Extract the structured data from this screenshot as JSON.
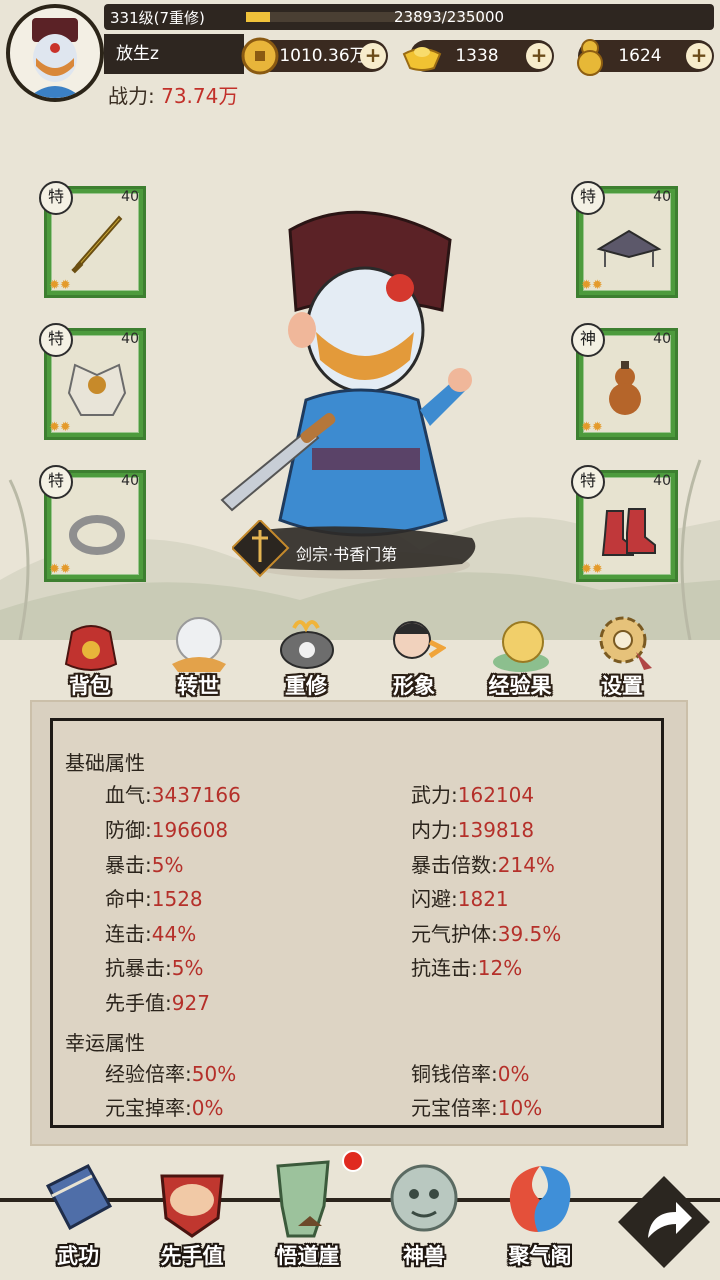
{
  "header": {
    "level_text": "331级(7重修)",
    "exp_text": "23893/235000",
    "exp_progress": 0.1017,
    "player_name": "放生z",
    "currencies": [
      {
        "name": "copper-coin",
        "value": "1010.36万",
        "plus": "+"
      },
      {
        "name": "gold-ingot",
        "value": "1338",
        "plus": "+"
      },
      {
        "name": "gold-gourd",
        "value": "1624",
        "plus": "+"
      }
    ],
    "power_label": "战力:",
    "power_value": "73.74万"
  },
  "equipment": {
    "left": [
      {
        "tag": "特",
        "level": "40",
        "item": "sword",
        "stars": "✹✹"
      },
      {
        "tag": "特",
        "level": "40",
        "item": "armor",
        "stars": "✹✹"
      },
      {
        "tag": "特",
        "level": "40",
        "item": "ring",
        "stars": "✹✹"
      }
    ],
    "right": [
      {
        "tag": "特",
        "level": "40",
        "item": "hat",
        "stars": "✹✹"
      },
      {
        "tag": "神",
        "level": "40",
        "item": "gourd",
        "stars": "✹✹"
      },
      {
        "tag": "特",
        "level": "40",
        "item": "boots",
        "stars": "✹✹"
      }
    ]
  },
  "character": {
    "sect": "剑宗·书香门第"
  },
  "menu": [
    {
      "label": "背包",
      "icon": "bag-icon"
    },
    {
      "label": "转世",
      "icon": "crystal-ball-icon"
    },
    {
      "label": "重修",
      "icon": "cauldron-icon"
    },
    {
      "label": "形象",
      "icon": "avatar-swap-icon"
    },
    {
      "label": "经验果",
      "icon": "exp-fruit-icon"
    },
    {
      "label": "设置",
      "icon": "settings-gear-icon"
    }
  ],
  "stats": {
    "basic_title": "基础属性",
    "basic": [
      {
        "label": "血气:",
        "value": "3437166"
      },
      {
        "label": "武力:",
        "value": "162104"
      },
      {
        "label": "防御:",
        "value": "196608"
      },
      {
        "label": "内力:",
        "value": "139818"
      },
      {
        "label": "暴击:",
        "value": "5%"
      },
      {
        "label": "暴击倍数:",
        "value": "214%"
      },
      {
        "label": "命中:",
        "value": "1528"
      },
      {
        "label": "闪避:",
        "value": "1821"
      },
      {
        "label": "连击:",
        "value": "44%"
      },
      {
        "label": "元气护体:",
        "value": "39.5%"
      },
      {
        "label": "抗暴击:",
        "value": "5%"
      },
      {
        "label": "抗连击:",
        "value": "12%"
      },
      {
        "label": "先手值:",
        "value": "927"
      }
    ],
    "luck_title": "幸运属性",
    "luck": [
      {
        "label": "经验倍率:",
        "value": "50%"
      },
      {
        "label": "铜钱倍率:",
        "value": "0%"
      },
      {
        "label": "元宝掉率:",
        "value": "0%"
      },
      {
        "label": "元宝倍率:",
        "value": "10%"
      }
    ]
  },
  "bottom_nav": [
    {
      "label": "武功",
      "icon": "martial-book-icon"
    },
    {
      "label": "先手值",
      "icon": "fist-icon"
    },
    {
      "label": "悟道崖",
      "icon": "cliff-icon"
    },
    {
      "label": "神兽",
      "icon": "beast-icon"
    },
    {
      "label": "聚气阁",
      "icon": "qi-swirl-icon"
    }
  ],
  "colors": {
    "accent_red": "#c2302a",
    "slot_green": "#4d9b3d",
    "background": "#e9e4d6"
  }
}
